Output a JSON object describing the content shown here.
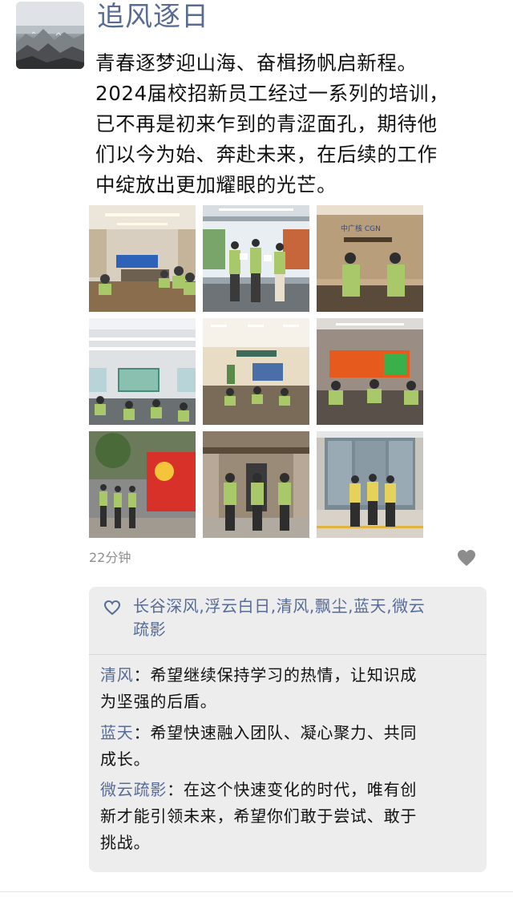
{
  "post": {
    "author": "追风逐日",
    "text_lines": [
      "青春逐梦迎山海、奋楫扬帆启新程。",
      "2024届校招新员工经过一系列的培训，",
      "已不再是初来乍到的青涩面孔，期待他",
      "们以今为始、奔赴未来，在后续的工作",
      "中绽放出更加耀眼的光芒。"
    ],
    "time": "22分钟",
    "avatar_icon": "mountain-landscape-avatar",
    "more_icon": "heart-comment-more-icon"
  },
  "photos": [
    {
      "name": "photo-meeting-room",
      "banner": ""
    },
    {
      "name": "photo-presentation-stage",
      "banner": ""
    },
    {
      "name": "photo-oath-cgn-wall",
      "banner": "中广核 CGN"
    },
    {
      "name": "photo-classroom",
      "banner": ""
    },
    {
      "name": "photo-training-hall",
      "banner": ""
    },
    {
      "name": "photo-orange-screen-seminar",
      "banner": ""
    },
    {
      "name": "photo-party-flag-wall",
      "banner": ""
    },
    {
      "name": "photo-memorial-building",
      "banner": ""
    },
    {
      "name": "photo-office-entrance",
      "banner": ""
    }
  ],
  "likes": {
    "icon": "heart-outline-icon",
    "names_line1": "长谷深风,浮云白日,清风,飘尘,蓝天,微云",
    "names_line2": "疏影"
  },
  "comments": [
    {
      "author": "清风",
      "sep": "：",
      "line1": "希望继续保持学习的热情，让知识成",
      "line2": "为坚强的后盾。"
    },
    {
      "author": "蓝天",
      "sep": "：",
      "line1": "希望快速融入团队、凝心聚力、共同",
      "line2": "成长。"
    },
    {
      "author": "微云疏影",
      "sep": "：",
      "line1": "在这个快速变化的时代，唯有创",
      "line2": "新才能引领未来，希望你们敢于尝试、敢于",
      "line3": "挑战。"
    }
  ],
  "colors": {
    "link_blue": "#576b95",
    "comment_bg": "#ededed",
    "time_gray": "#8e8e8e",
    "shirt_green": "#a8c86a"
  }
}
